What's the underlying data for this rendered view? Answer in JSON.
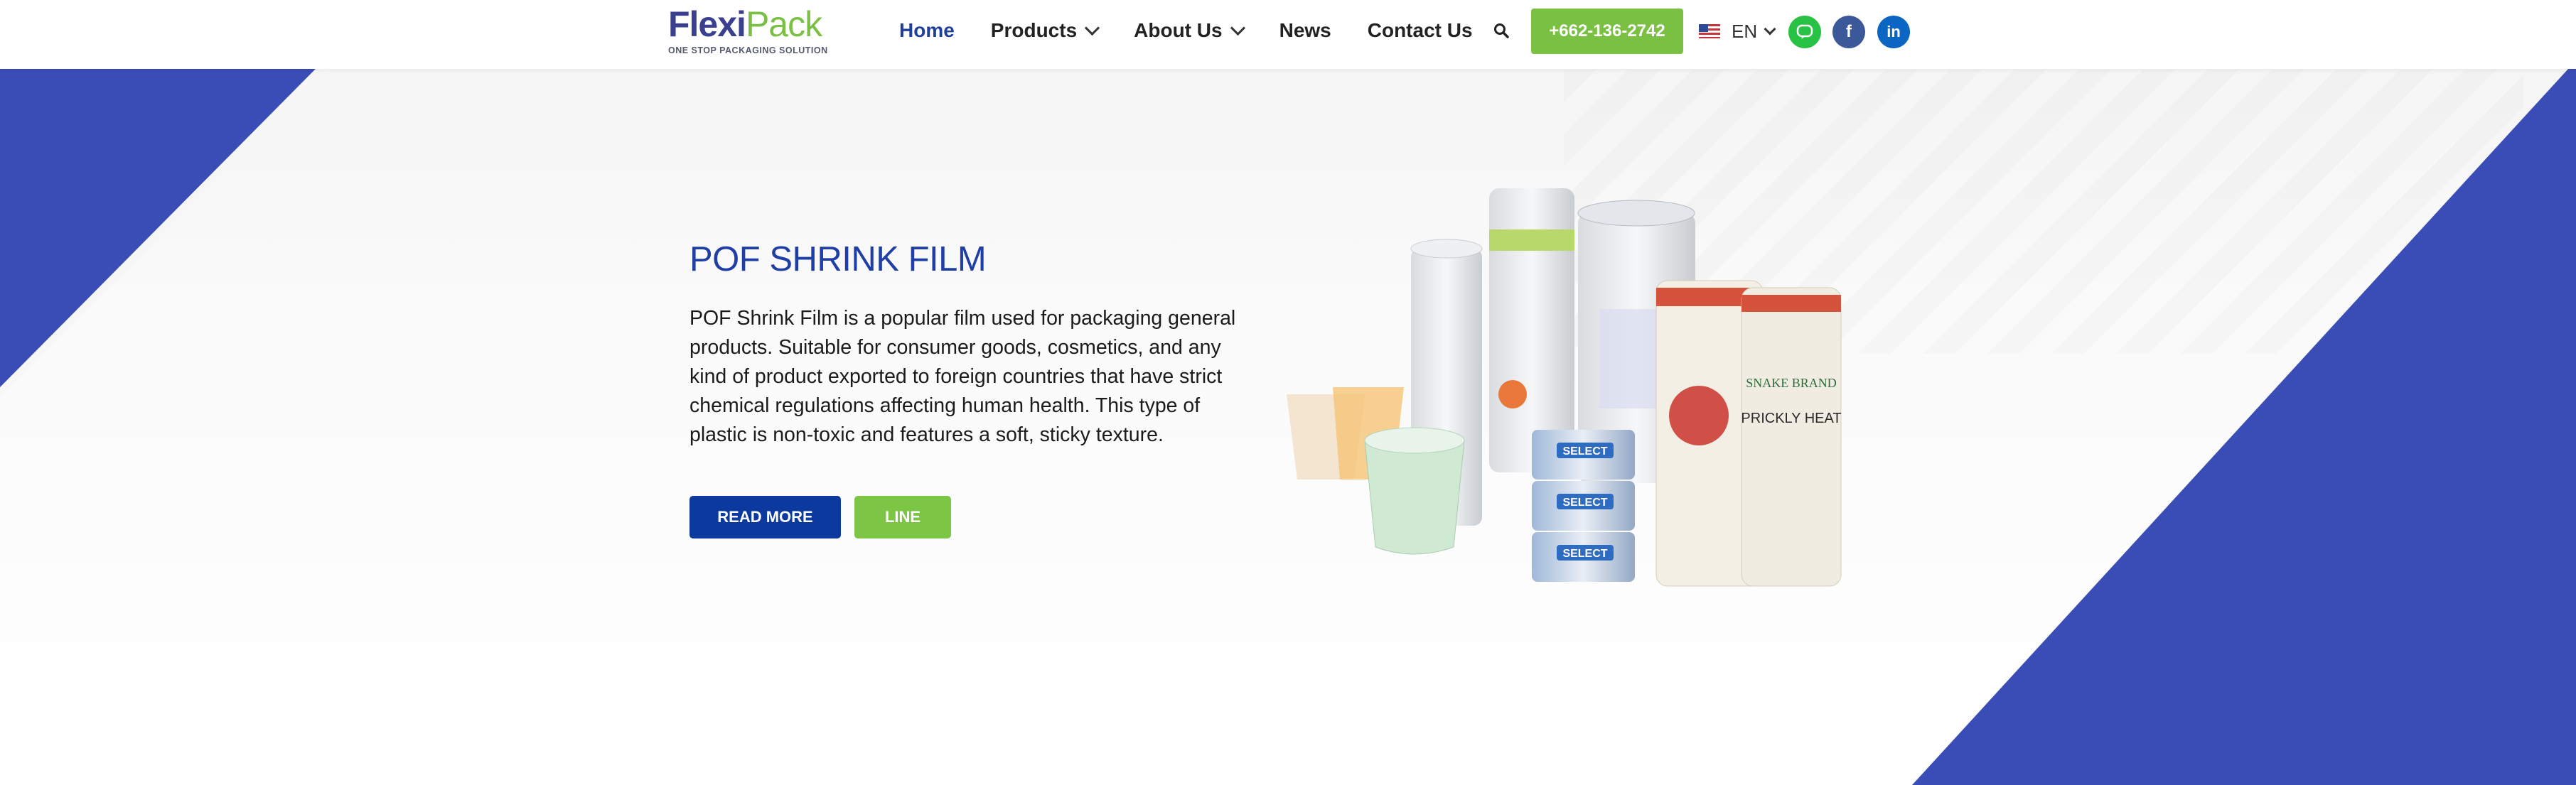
{
  "brand": {
    "logo_main_a": "Flexi",
    "logo_main_b": "Pack",
    "tagline": "ONE STOP PACKAGING SOLUTION",
    "colors": {
      "navy": "#3b3f8f",
      "green": "#7ac043",
      "hero_blue": "#1f3fa6",
      "button_blue": "#0c399e",
      "background_blue": "#3a4db7"
    }
  },
  "nav": {
    "items": [
      {
        "label": "Home",
        "active": true
      },
      {
        "label": "Products",
        "dropdown": true
      },
      {
        "label": "About Us",
        "dropdown": true
      },
      {
        "label": "News"
      },
      {
        "label": "Contact Us"
      }
    ],
    "search_icon": "search-icon",
    "phone": "+662-136-2742",
    "language": "EN",
    "socials": [
      "line-icon",
      "facebook-icon",
      "linkedin-icon"
    ]
  },
  "hero": {
    "title": "POF SHRINK FILM",
    "description": "POF Shrink Film is a popular film used for packaging general products. Suitable for consumer goods, cosmetics, and any kind of product exported to foreign countries that have strict chemical regulations affecting human health. This type of plastic is non-toxic and features a soft, sticky texture.",
    "read_more_label": "READ MORE",
    "line_label": "LINE",
    "product_labels": {
      "snake_brand": "SNAKE BRAND",
      "prickly_heat": "PRICKLY HEAT",
      "select": "SELECT"
    }
  }
}
